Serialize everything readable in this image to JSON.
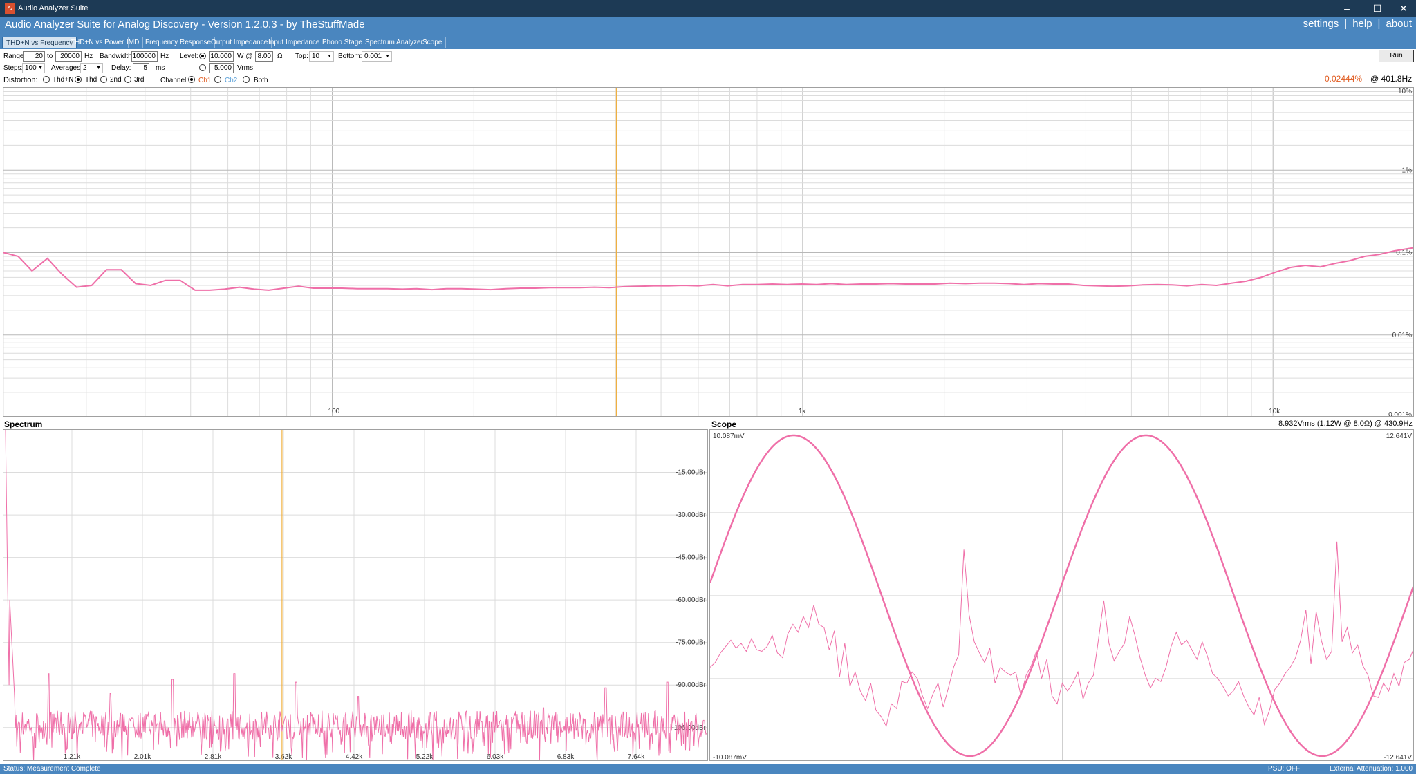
{
  "window": {
    "title": "Audio Analyzer Suite"
  },
  "header": {
    "app_title": "Audio Analyzer Suite for Analog Discovery - Version   1.2.0.3   - by TheStuffMade",
    "links": [
      "settings",
      "help",
      "about"
    ]
  },
  "tabs": [
    {
      "label": "THD+N vs Frequency",
      "active": true
    },
    {
      "label": "THD+N vs Power"
    },
    {
      "label": "IMD"
    },
    {
      "label": "Frequency Response"
    },
    {
      "label": "Output Impedance"
    },
    {
      "label": "Input Impedance"
    },
    {
      "label": "Phono Stage"
    },
    {
      "label": "Spectrum Analyzer"
    },
    {
      "label": "Scope"
    }
  ],
  "controls": {
    "range_label": "Range:",
    "range_from": "20",
    "to_label": "to",
    "range_to": "20000",
    "hz1": "Hz",
    "bandwidth_label": "Bandwidth:",
    "bandwidth": "100000",
    "hz2": "Hz",
    "level_label": "Level:",
    "level_watts": "10.000",
    "w_at": "W @",
    "load": "8.00",
    "ohm": "Ω",
    "level_vrms": "5.000",
    "vrms": "Vrms",
    "top_label": "Top:",
    "top_value": "10",
    "bottom_label": "Bottom:",
    "bottom_value": "0.001",
    "steps_label": "Steps:",
    "steps_value": "100",
    "averages_label": "Averages:",
    "averages_value": "2",
    "delay_label": "Delay:",
    "delay_value": "5",
    "ms": "ms",
    "distortion_label": "Distortion:",
    "distortion_options": [
      "Thd+N",
      "Thd",
      "2nd",
      "3rd"
    ],
    "distortion_selected": "Thd",
    "channel_label": "Channel:",
    "channel_options": [
      "Ch1",
      "Ch2",
      "Both"
    ],
    "channel_selected": "Ch1",
    "run_label": "Run"
  },
  "readout": {
    "value": "0.02444%",
    "freq": "@ 401.8Hz",
    "value_color": "#e05a1e"
  },
  "colors": {
    "trace": "#ef6fa8",
    "cursor": "#f0b040",
    "ch2": "#5aa0d8"
  },
  "chart_data": [
    {
      "name": "thd-vs-frequency",
      "type": "line",
      "x_scale": "log",
      "xlim": [
        20,
        20000
      ],
      "ylim": [
        0.001,
        10
      ],
      "y_scale": "log",
      "x_ticks": [
        {
          "v": 100,
          "label": "100"
        },
        {
          "v": 1000,
          "label": "1k"
        },
        {
          "v": 10000,
          "label": "10k"
        }
      ],
      "y_ticks": [
        {
          "v": 10,
          "label": "10%"
        },
        {
          "v": 1,
          "label": "1%"
        },
        {
          "v": 0.1,
          "label": "0.1%"
        },
        {
          "v": 0.01,
          "label": "0.01%"
        },
        {
          "v": 0.001,
          "label": "0.001%"
        }
      ],
      "cursor_x": 401.8,
      "series": [
        {
          "x": [
            20,
            21.5,
            23,
            24.8,
            26.6,
            28.6,
            30.8,
            33.1,
            35.6,
            38.2,
            41.1,
            44.2,
            47.5,
            51.1,
            54.9,
            59.0,
            63.5,
            68.2,
            73.3,
            78.9,
            84.8,
            91.1,
            98,
            105,
            113,
            122,
            131,
            141,
            151,
            163,
            175,
            188,
            202,
            217,
            234,
            251,
            270,
            290,
            312,
            336,
            361,
            388,
            417,
            449,
            482,
            519,
            558,
            600,
            645,
            693,
            745,
            801,
            862,
            927,
            996,
            1071,
            1151,
            1238,
            1331,
            1431,
            1539,
            1655,
            1779,
            1913,
            2057,
            2211,
            2378,
            2556,
            2749,
            2955,
            3178,
            3417,
            3673,
            3950,
            4246,
            4566,
            4909,
            5278,
            5675,
            6102,
            6561,
            7054,
            7585,
            8155,
            8768,
            9428,
            10137,
            10899,
            11718,
            12600,
            13547,
            14566,
            15661,
            16839,
            18105,
            20000
          ],
          "y": [
            0.1,
            0.09,
            0.06,
            0.085,
            0.055,
            0.038,
            0.04,
            0.062,
            0.062,
            0.042,
            0.04,
            0.046,
            0.046,
            0.035,
            0.035,
            0.036,
            0.038,
            0.036,
            0.035,
            0.037,
            0.039,
            0.037,
            0.037,
            0.037,
            0.0365,
            0.0365,
            0.0365,
            0.036,
            0.0365,
            0.0355,
            0.0365,
            0.0365,
            0.036,
            0.0355,
            0.0365,
            0.037,
            0.037,
            0.0375,
            0.0375,
            0.0375,
            0.038,
            0.0375,
            0.0385,
            0.039,
            0.0395,
            0.0395,
            0.04,
            0.0395,
            0.041,
            0.0395,
            0.041,
            0.041,
            0.0415,
            0.041,
            0.0415,
            0.041,
            0.042,
            0.041,
            0.0415,
            0.0415,
            0.042,
            0.0415,
            0.0415,
            0.0415,
            0.0425,
            0.042,
            0.0425,
            0.0425,
            0.042,
            0.041,
            0.042,
            0.0415,
            0.0415,
            0.04,
            0.0395,
            0.039,
            0.0395,
            0.0405,
            0.041,
            0.0405,
            0.0395,
            0.041,
            0.04,
            0.0425,
            0.045,
            0.05,
            0.058,
            0.066,
            0.07,
            0.067,
            0.074,
            0.08,
            0.09,
            0.095,
            0.105,
            0.115
          ]
        }
      ]
    },
    {
      "name": "spectrum",
      "type": "line",
      "title": "Spectrum",
      "y_unit": "dBr",
      "ylim": [
        -117,
        0
      ],
      "x_ticks": [
        "1.21k",
        "2.01k",
        "2.81k",
        "3.62k",
        "4.42k",
        "5.22k",
        "6.03k",
        "6.83k",
        "7.64k"
      ],
      "y_ticks": [
        "-15.00dBr",
        "-30.00dBr",
        "-45.00dBr",
        "-60.00dBr",
        "-75.00dBr",
        "-90.00dBr",
        "-105.00dBr"
      ],
      "cursor_pos": 0.395,
      "fundamental_peak_db": 0,
      "harmonic_peak_db": [
        -86,
        -93,
        -88,
        -86,
        -89,
        -94,
        -104,
        -103,
        -98,
        -91,
        -89
      ],
      "noise_floor_db": -104
    },
    {
      "name": "scope",
      "type": "line",
      "title": "Scope",
      "info": "8.932Vrms (1.12W @ 8.0Ω) @ 430.9Hz",
      "left_top": "10.087mV",
      "left_bottom": "-10.087mV",
      "right_top": "12.641V",
      "right_bottom": "-12.641V",
      "periods": 2,
      "series": [
        {
          "name": "signal",
          "type": "sine",
          "amplitude": 12.641
        },
        {
          "name": "distortion-residual",
          "samples_mV": [
            -4.5,
            -4.2,
            -3.6,
            -3.2,
            -2.8,
            -3.3,
            -3.0,
            -3.5,
            -2.7,
            -3.4,
            -3.5,
            -3.2,
            -2.5,
            -3.6,
            -3.9,
            -2.4,
            -1.8,
            -2.3,
            -1.3,
            -2.0,
            -0.6,
            -1.8,
            -2.0,
            -3.4,
            -2.2,
            -5.1,
            -3.0,
            -5.7,
            -4.8,
            -6.0,
            -6.6,
            -5.5,
            -7.2,
            -7.6,
            -8.2,
            -6.8,
            -7.1,
            -5.4,
            -5.5,
            -4.8,
            -5.2,
            -6.3,
            -7.1,
            -6.2,
            -5.5,
            -7.0,
            -5.8,
            -4.5,
            -3.7,
            2.9,
            -1.2,
            -2.9,
            -3.6,
            -4.2,
            -3.3,
            -5.5,
            -4.5,
            -4.8,
            -5.0,
            -4.8,
            -6.3,
            -5.0,
            -4.4,
            -3.5,
            -5.2,
            -4.0,
            -6.3,
            -6.8,
            -5.5,
            -6.0,
            -5.5,
            -4.8,
            -6.5,
            -5.5,
            -5.0,
            -2.7,
            -0.3,
            -3.0,
            -4.1,
            -3.5,
            -3.0,
            -1.3,
            -2.5,
            -3.9,
            -5.0,
            -5.8,
            -5.2,
            -5.4,
            -4.5,
            -3.2,
            -2.3,
            -3.1,
            -2.8,
            -3.4,
            -4.0,
            -2.9,
            -3.8,
            -4.9,
            -5.2,
            -5.7,
            -6.3,
            -6.0,
            -5.4,
            -6.3,
            -7.0,
            -7.5,
            -6.4,
            -8.1,
            -7.2,
            -5.9,
            -5.5,
            -4.9,
            -4.5,
            -3.9,
            -2.8,
            -0.9,
            -4.3,
            -1.0,
            -2.8,
            -4.0,
            -3.5,
            3.4,
            -2.9,
            -2.0,
            -3.6,
            -3.1,
            -4.4,
            -5.0,
            -6.3,
            -6.4,
            -5.5,
            -6.0,
            -4.9,
            -5.7,
            -4.2,
            -4.0,
            -3.2
          ]
        }
      ]
    }
  ],
  "status": {
    "left": "Status: Measurement Complete",
    "psu": "PSU: OFF",
    "attenuation": "External Attenuation: 1.000"
  }
}
